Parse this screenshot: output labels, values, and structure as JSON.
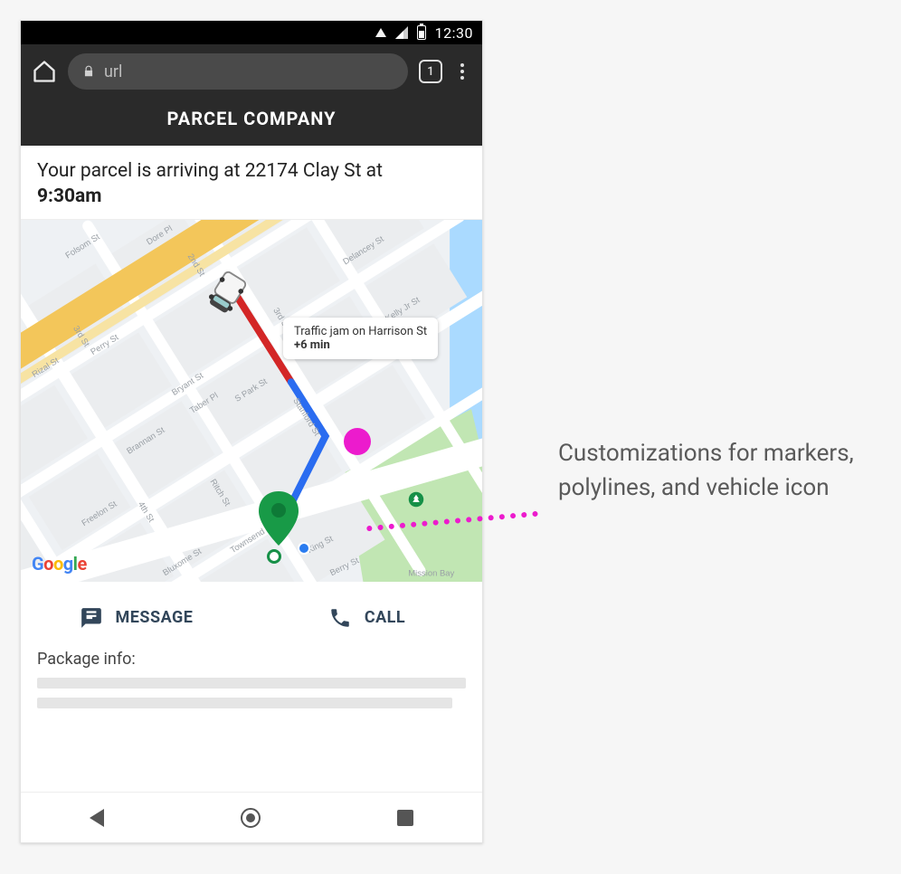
{
  "statusbar": {
    "time": "12:30"
  },
  "browser": {
    "url_placeholder": "url",
    "tab_count": "1"
  },
  "app": {
    "title": "PARCEL COMPANY"
  },
  "heading": {
    "prefix": "Your parcel is arriving at ",
    "address": "22174 Clay St",
    "middle": " at ",
    "time": "9:30am"
  },
  "map": {
    "attribution": {
      "g1": "G",
      "o1": "o",
      "o2": "o",
      "g2": "g",
      "l": "l",
      "e": "e"
    },
    "traffic": {
      "line1": "Traffic jam on Harrison St",
      "delay": "+6 min"
    },
    "labels": {
      "folsom": "Folsom St",
      "dore": "Dore Pl",
      "second": "2nd St",
      "delancey": "Delancey St",
      "third": "3rd St",
      "perry": "Perry St",
      "jpkelly": "John P Kelly Jr St",
      "rizal": "Rizal St",
      "bryant": "Bryant St",
      "taber": "Taber Pl",
      "spark": "S Park St",
      "stanford": "Stanford St",
      "brannan": "Brannan St",
      "fourth": "4th St",
      "ritch": "Ritch St",
      "freelon": "Freelon St",
      "townsend": "Townsend St",
      "bluxome": "Bluxome St",
      "king": "King St",
      "berry": "Berry St",
      "missionbay": "Mission Bay"
    }
  },
  "actions": {
    "message": "MESSAGE",
    "call": "CALL"
  },
  "package": {
    "label": "Package info:"
  },
  "annotation": {
    "text": "Customizations for markers, polylines, and vehicle icon"
  }
}
